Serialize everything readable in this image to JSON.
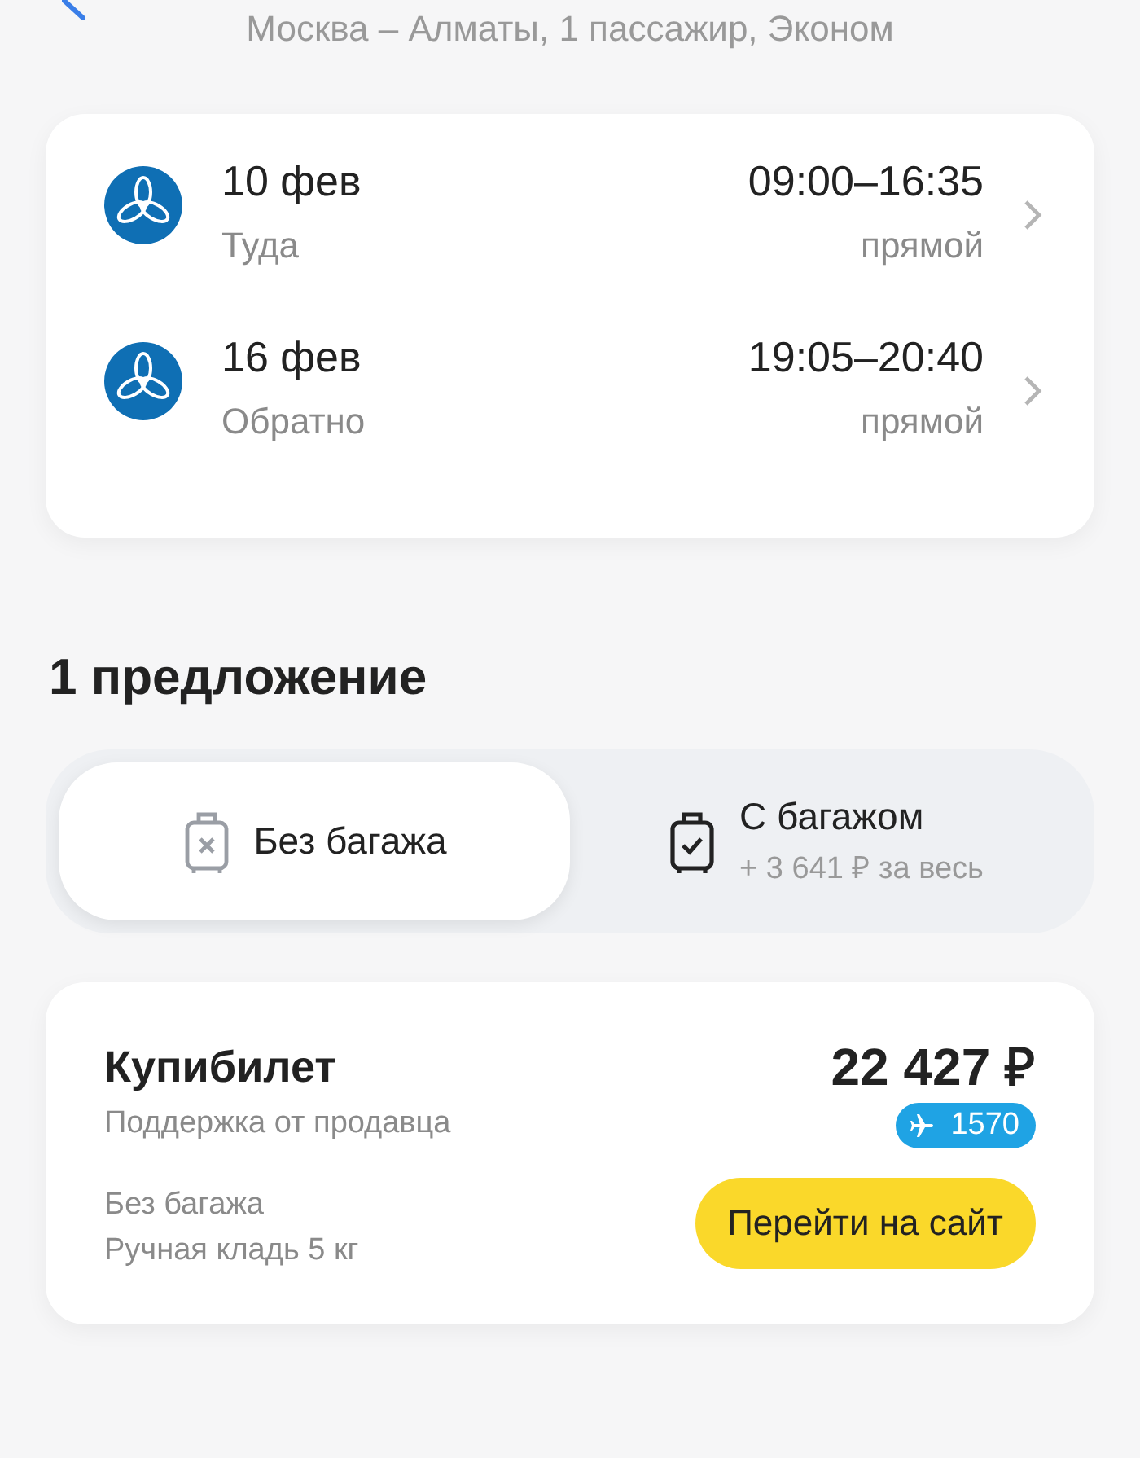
{
  "header": {
    "subtitle": "Москва – Алматы, 1 пассажир, Эконом"
  },
  "flights": [
    {
      "date": "10 фев",
      "direction": "Туда",
      "times": "09:00–16:35",
      "stops": "прямой"
    },
    {
      "date": "16 фев",
      "direction": "Обратно",
      "times": "19:05–20:40",
      "stops": "прямой"
    }
  ],
  "offers_title": "1 предложение",
  "baggage_tabs": [
    {
      "kind": "no-bag",
      "label": "Без багажа",
      "selected": true
    },
    {
      "kind": "bag",
      "label": "С багажом",
      "note": "+ 3 641 ₽ за весь",
      "selected": false
    }
  ],
  "offer": {
    "seller": "Купибилет",
    "support": "Поддержка от продавца",
    "price": "22 427 ₽",
    "bonus": "1570",
    "baggage": "Без багажа",
    "hand_luggage": "Ручная кладь 5 кг",
    "button": "Перейти на сайт"
  }
}
